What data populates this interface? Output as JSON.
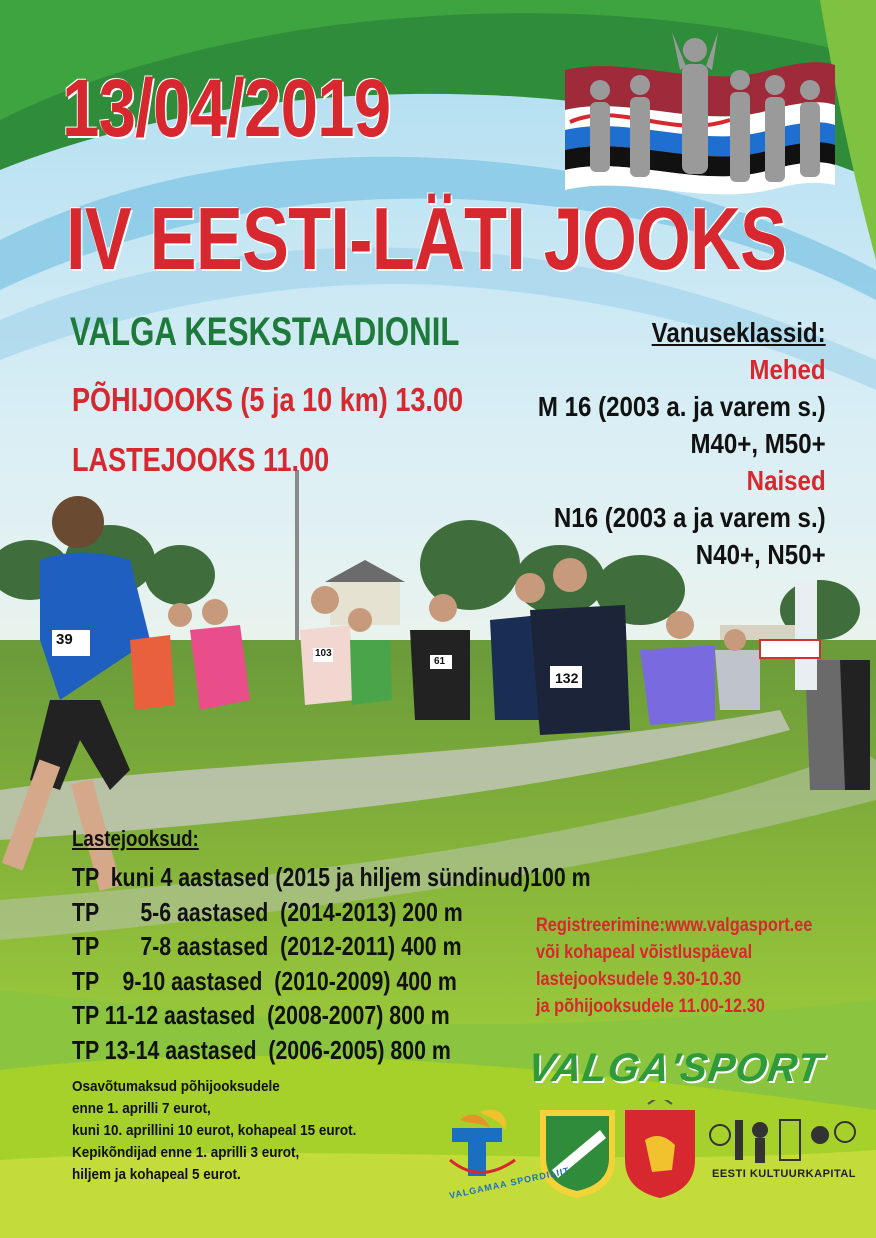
{
  "date": "13/04/2019",
  "title": "IV EESTI-LÄTI JOOKS",
  "venue": "VALGA KESKSTAADIONIL",
  "main_race": "PÕHIJOOKS (5 ja 10 km) 13.00",
  "kids_race": "LASTEJOOKS 11.00",
  "age_classes": {
    "header": "Vanuseklassid:",
    "men_label": "Mehed",
    "men_line1": "M 16 (2003 a. ja varem s.)",
    "men_line2": "M40+, M50+",
    "women_label": "Naised",
    "women_line1": "N16 (2003 a ja varem s.)",
    "women_line2": "N40+, N50+"
  },
  "kids_runs": {
    "header": "Lastejooksud:",
    "rows": [
      "TP  kuni 4 aastased (2015 ja hiljem sündinud)100 m",
      "TP       5-6 aastased  (2014-2013) 200 m",
      "TP       7-8 aastased  (2012-2011) 400 m",
      "TP    9-10 aastased  (2010-2009) 400 m",
      "TP 11-12 aastased  (2008-2007) 800 m",
      "TP 13-14 aastased  (2006-2005) 800 m"
    ]
  },
  "registration": [
    "Registreerimine:www.valgasport.ee",
    "või kohapeal võistluspäeval",
    "lastejooksudele 9.30-10.30",
    "ja põhijooksudele 11.00-12.30"
  ],
  "fees": [
    "Osavõtumaksud põhijooksudele",
    "enne 1. aprilli 7 eurot,",
    "kuni 10. aprillini 10 eurot, kohapeal 15 eurot.",
    "Kepikõndijad enne 1. aprilli 3 eurot,",
    "hiljem ja kohapeal 5 eurot."
  ],
  "sponsors": {
    "valgasport_logo": "VALGA'SPORT",
    "valgamaa_spordiliit": "VALGAMAA SPORDILIIT",
    "kultuurkapital": "EESTI KULTUURKAPITAL"
  },
  "bibs": [
    "39",
    "103",
    "61",
    "132"
  ],
  "colors": {
    "red": "#d7282f",
    "green": "#1e7a3a",
    "lime": "#a6d02a",
    "sky": "#8ccbe8"
  }
}
